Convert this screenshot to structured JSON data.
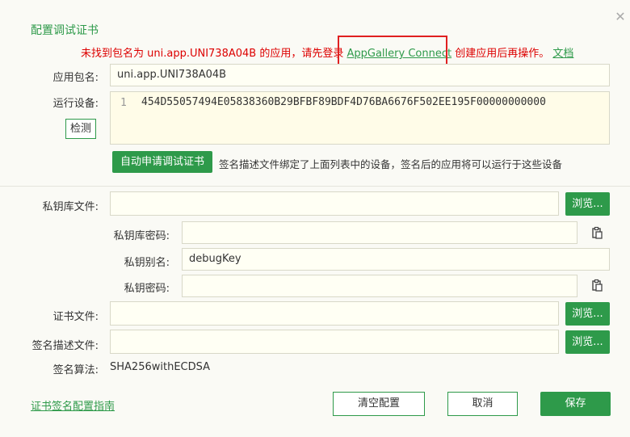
{
  "dialog": {
    "title": "配置调试证书",
    "warning_prefix": "未找到包名为 uni.app.UNI738A04B 的应用，请先登录",
    "warning_link": "AppGallery Connect",
    "warning_suffix": "创建应用后再操作。",
    "warning_doc": "文档"
  },
  "form": {
    "package_label": "应用包名:",
    "package_value": "uni.app.UNI738A04B",
    "device_label": "运行设备:",
    "device_line_no": "1",
    "device_value": "454D55057494E05838360B29BFBF89BDF4D76BA6676F502EE195F00000000000",
    "detect_button": "检测",
    "auto_apply_button": "自动申请调试证书",
    "auto_apply_desc": "签名描述文件绑定了上面列表中的设备，签名后的应用将可以运行于这些设备",
    "keystore_label": "私钥库文件:",
    "keystore_value": "",
    "browse_label": "浏览...",
    "keystore_pwd_label": "私钥库密码:",
    "keystore_pwd_value": "",
    "alias_label": "私钥别名:",
    "alias_value": "debugKey",
    "key_pwd_label": "私钥密码:",
    "key_pwd_value": "",
    "cert_label": "证书文件:",
    "cert_value": "",
    "profile_label": "签名描述文件:",
    "profile_value": "",
    "algo_label": "签名算法:",
    "algo_value": "SHA256withECDSA"
  },
  "footer": {
    "guide_link": "证书签名配置指南",
    "clear_button": "清空配置",
    "cancel_button": "取消",
    "save_button": "保存"
  },
  "icons": {
    "close": "close-icon",
    "paste": "clipboard-icon"
  },
  "colors": {
    "accent": "#2e9a4a",
    "warning": "#dd0000",
    "highlight_box": "#e02020"
  }
}
